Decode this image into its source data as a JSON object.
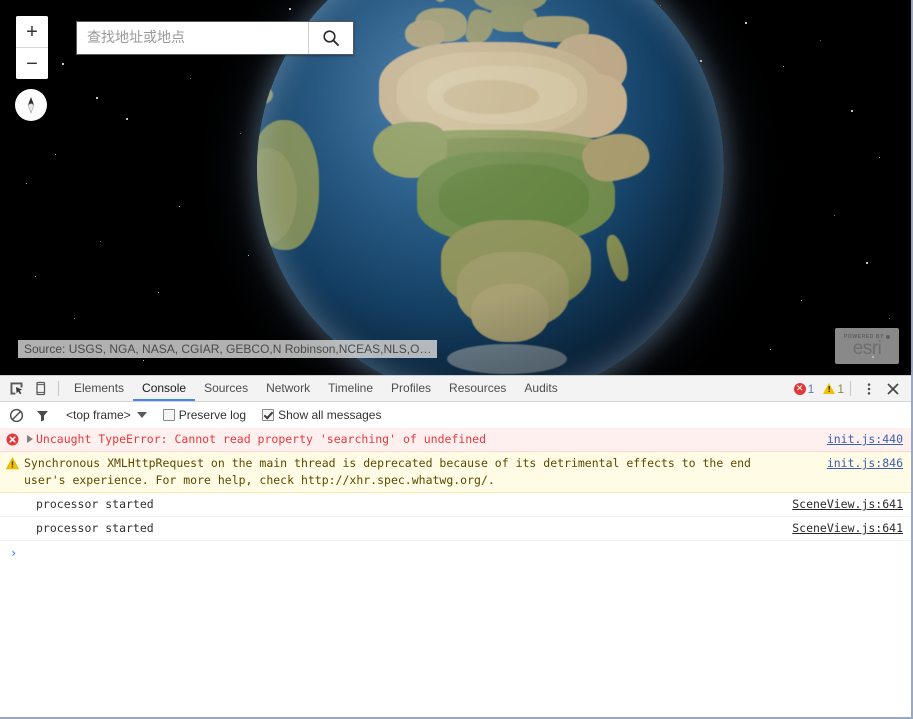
{
  "map": {
    "zoom_in_label": "+",
    "zoom_out_label": "−",
    "compass_name": "compass-north-arrow",
    "search": {
      "placeholder": "查找地址或地点",
      "value": "",
      "button_icon": "search-icon"
    },
    "attribution": "Source: USGS, NGA, NASA, CGIAR, GEBCO,N Robinson,NCEAS,NLS,O…",
    "logo": {
      "powered_by": "POWERED BY",
      "brand": "esri"
    },
    "background_color": "#000000",
    "ocean_color": "#1e537f",
    "land_color": "#b9a98a"
  },
  "devtools": {
    "toolbar": {
      "inspect_icon": "inspect-element-icon",
      "device_icon": "device-toolbar-icon",
      "tabs": [
        {
          "label": "Elements",
          "active": false
        },
        {
          "label": "Console",
          "active": true
        },
        {
          "label": "Sources",
          "active": false
        },
        {
          "label": "Network",
          "active": false
        },
        {
          "label": "Timeline",
          "active": false
        },
        {
          "label": "Profiles",
          "active": false
        },
        {
          "label": "Resources",
          "active": false
        },
        {
          "label": "Audits",
          "active": false
        }
      ],
      "error_count": "1",
      "warning_count": "1",
      "menu_icon": "more-options-icon",
      "close_icon": "close-icon",
      "active_tab_color": "#4285f4"
    },
    "filterbar": {
      "clear_icon": "clear-console-icon",
      "filter_icon": "filter-icon",
      "frame_selector": "<top frame>",
      "preserve_log": {
        "label": "Preserve log",
        "checked": false
      },
      "show_all_messages": {
        "label": "Show all messages",
        "checked": true
      }
    },
    "messages": [
      {
        "level": "error",
        "icon": "error-icon",
        "expandable": true,
        "text": "Uncaught TypeError: Cannot read property 'searching' of undefined",
        "source": "init.js:440"
      },
      {
        "level": "warn",
        "icon": "warning-icon",
        "expandable": false,
        "text": "Synchronous XMLHttpRequest on the main thread is deprecated because of its detrimental effects to the end user's experience. For more help, check http://xhr.spec.whatwg.org/.",
        "source": "init.js:846"
      },
      {
        "level": "log",
        "icon": "",
        "expandable": false,
        "text": "processor started",
        "source": "SceneView.js:641"
      },
      {
        "level": "log",
        "icon": "",
        "expandable": false,
        "text": "processor started",
        "source": "SceneView.js:641"
      }
    ],
    "prompt": {
      "caret": "›",
      "value": ""
    },
    "colors": {
      "error_background": "#fff0f0",
      "error_text": "#e8393d",
      "warning_background": "#fffbe5",
      "warning_text": "#5c4a00",
      "link": "#3b5fb0"
    }
  }
}
